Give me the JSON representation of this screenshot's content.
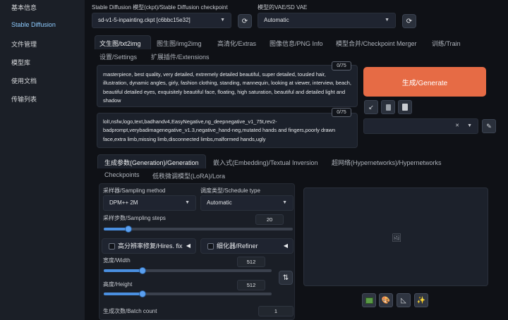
{
  "nav": {
    "items": [
      {
        "label": "基本信息",
        "active": false
      },
      {
        "label": "Stable Diffusion",
        "active": true
      },
      {
        "label": "文件管理",
        "active": false
      },
      {
        "label": "模型库",
        "active": false
      },
      {
        "label": "使用文档",
        "active": false
      },
      {
        "label": "传输列表",
        "active": false
      }
    ]
  },
  "header": {
    "checkpoint_label": "Stable Diffusion 模型(ckpt)/Stable Diffusion checkpoint",
    "checkpoint_value": "sd-v1-5-inpainting.ckpt [c6bbc15e32]",
    "vae_label": "模型的VAE/SD VAE",
    "vae_value": "Automatic"
  },
  "tabs": [
    {
      "label": "文生图/txt2img",
      "active": true
    },
    {
      "label": "图生图/img2img",
      "active": false
    },
    {
      "label": "高清化/Extras",
      "active": false
    },
    {
      "label": "图像信息/PNG Info",
      "active": false
    },
    {
      "label": "模型合并/Checkpoint Merger",
      "active": false
    },
    {
      "label": "训练/Train",
      "active": false
    },
    {
      "label": "设置/Settings",
      "active": false
    },
    {
      "label": "扩展插件/Extensions",
      "active": false
    }
  ],
  "prompt": {
    "counter": "0/75",
    "text": "masterpiece, best quality, very detailed, extremely detailed beautiful, super detailed, tousled hair, illustration, dynamic angles, girly, fashion clothing, standing, mannequin, looking at viewer, interview, beach, beautiful detailed eyes, exquisitely beautiful face, floating, high saturation, beautiful and detailed light and shadow"
  },
  "negative_prompt": {
    "counter": "0/75",
    "text": "lolI,nsfw,logo,text,badhandv4,EasyNegative,ng_deepnegative_v1_75t,rev2-badprompt,verybadimagenegative_v1.3,negative_hand-neg,mutated hands and fingers,poorly drawn face,extra limb,missing limb,disconnected limbs,malformed hands,ugly"
  },
  "generate": {
    "label": "生成/Generate"
  },
  "sub_tabs": [
    {
      "label": "生成参数(Generation)/Generation",
      "active": true
    },
    {
      "label": "嵌入式(Embedding)/Textual Inversion",
      "active": false
    },
    {
      "label": "超网络(Hypernetworks)/Hypernetworks",
      "active": false
    },
    {
      "label": "Checkpoints",
      "active": false
    },
    {
      "label": "低秩微调模型(LoRA)/Lora",
      "active": false
    }
  ],
  "params": {
    "sampler_label": "采样器/Sampling method",
    "sampler_value": "DPM++ 2M",
    "schedule_label": "调度类型/Schedule type",
    "schedule_value": "Automatic",
    "steps_label": "采样步数/Sampling steps",
    "steps_value": "20",
    "steps_fraction": 0.13,
    "hires_label": "高分辨率修复/Hires. fix",
    "refiner_label": "细化器/Refiner",
    "width_label": "宽度/Width",
    "width_value": "512",
    "width_fraction": 0.23,
    "height_label": "高度/Height",
    "height_value": "512",
    "height_fraction": 0.23,
    "batch_count_label": "生成次数/Batch count",
    "batch_count_value": "1"
  },
  "colors": {
    "accent": "#e66b45",
    "slider": "#4a8fe0",
    "active_nav": "#8ecbff"
  }
}
